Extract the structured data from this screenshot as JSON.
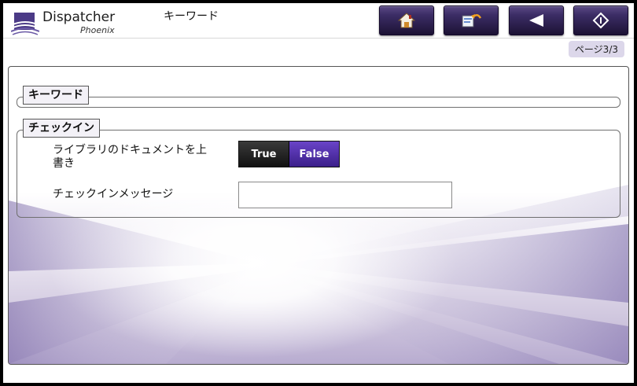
{
  "header": {
    "app_name": "Dispatcher",
    "app_sub": "Phoenix",
    "screen_title": "キーワード",
    "buttons": [
      {
        "name": "home-button",
        "icon": "home-icon"
      },
      {
        "name": "reset-button",
        "icon": "reset-icon"
      },
      {
        "name": "back-button",
        "icon": "back-arrow-icon"
      },
      {
        "name": "start-button",
        "icon": "start-icon"
      }
    ]
  },
  "page_indicator": "ページ3/3",
  "groups": {
    "keyword": {
      "label": "キーワード"
    },
    "checkin": {
      "label": "チェックイン",
      "fields": {
        "overwrite_label": "ライブラリのドキュメントを上書き",
        "overwrite_true": "True",
        "overwrite_false": "False",
        "overwrite_value": "False",
        "message_label": "チェックインメッセージ",
        "message_value": ""
      }
    }
  },
  "colors": {
    "toolbar_button": "#3c2d66",
    "toggle_selected": "#5a36b8",
    "page_indicator_bg": "#dcd7ea"
  }
}
